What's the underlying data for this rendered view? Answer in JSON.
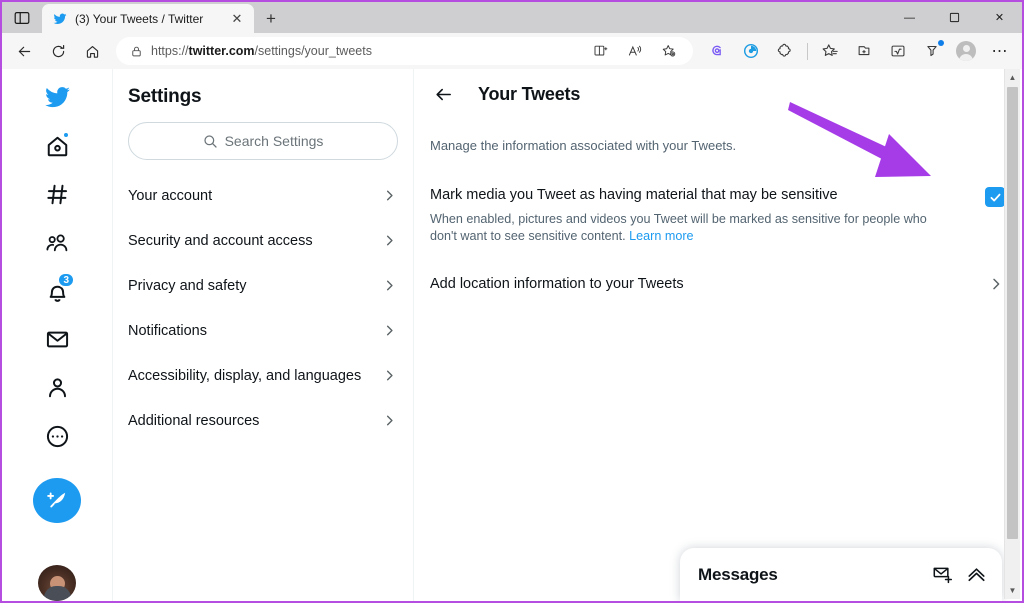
{
  "browser": {
    "tab": {
      "title": "(3) Your Tweets / Twitter",
      "favicon": "twitter-bird-icon",
      "close_label": "✕"
    },
    "new_tab_label": "+",
    "tab_actions_icon": "tab-actions-icon",
    "window_controls": {
      "minimize": "—",
      "maximize": "❐",
      "close": "✕"
    },
    "nav": {
      "back_icon": "back-arrow-icon",
      "refresh_icon": "refresh-icon",
      "home_icon": "home-icon"
    },
    "omnibox": {
      "lock_icon": "lock-icon",
      "url_scheme": "https://",
      "url_host": "twitter.com",
      "url_path": "/settings/your_tweets",
      "full_url": "https://twitter.com/settings/your_tweets",
      "inline_icons": [
        "split-screen-icon",
        "read-aloud-icon",
        "favorite-settings-icon"
      ]
    },
    "toolbar_icons": [
      "copilot-icon",
      "edge-browser-essentials-icon",
      "extensions-puzzle-icon",
      "favorites-icon",
      "collections-icon",
      "math-solver-icon",
      "browser-essentials-icon",
      "profile-avatar-icon",
      "settings-more-icon"
    ],
    "more_label": "⋯"
  },
  "rail": {
    "items": [
      {
        "name": "twitter-logo",
        "label": "Twitter",
        "badge": null
      },
      {
        "name": "home",
        "label": "Home",
        "badge": "dot"
      },
      {
        "name": "explore",
        "label": "Explore",
        "badge": null
      },
      {
        "name": "communities",
        "label": "Communities",
        "badge": null
      },
      {
        "name": "notifications",
        "label": "Notifications",
        "badge": "3"
      },
      {
        "name": "messages",
        "label": "Messages",
        "badge": null
      },
      {
        "name": "profile",
        "label": "Profile",
        "badge": null
      },
      {
        "name": "more",
        "label": "More",
        "badge": null
      }
    ],
    "compose_label": "Tweet",
    "avatar_label": "Account avatar"
  },
  "settings": {
    "title": "Settings",
    "search": {
      "placeholder": "Search Settings",
      "value": ""
    },
    "nav_items": [
      {
        "label": "Your account"
      },
      {
        "label": "Security and account access"
      },
      {
        "label": "Privacy and safety"
      },
      {
        "label": "Notifications"
      },
      {
        "label": "Accessibility, display, and languages"
      },
      {
        "label": "Additional resources"
      }
    ]
  },
  "main": {
    "title": "Your Tweets",
    "subtitle": "Manage the information associated with your Tweets.",
    "preference": {
      "label": "Mark media you Tweet as having material that may be sensitive",
      "description_before_link": "When enabled, pictures and videos you Tweet will be marked as sensitive for people who don't want to see sensitive content. ",
      "link_label": "Learn more",
      "checked": true,
      "check_glyph": "✓"
    },
    "location_row": {
      "label": "Add location information to your Tweets"
    }
  },
  "messages_dock": {
    "title": "Messages",
    "new_message_icon": "new-message-icon",
    "expand_icon": "chevron-up-icon"
  },
  "annotation": {
    "arrow_color": "#a63ce8",
    "window_border_color": "#b44de0",
    "description": "purple arrow pointing to sensitive-media checkbox"
  },
  "colors": {
    "twitter_blue": "#1d9bf0",
    "text_primary": "#0f1419",
    "text_secondary": "#536471",
    "chrome_bg": "#f6f6f6",
    "tabstrip_bg": "#cfcfd1"
  },
  "scrollbar": {
    "up_glyph": "▲",
    "down_glyph": "▼"
  }
}
